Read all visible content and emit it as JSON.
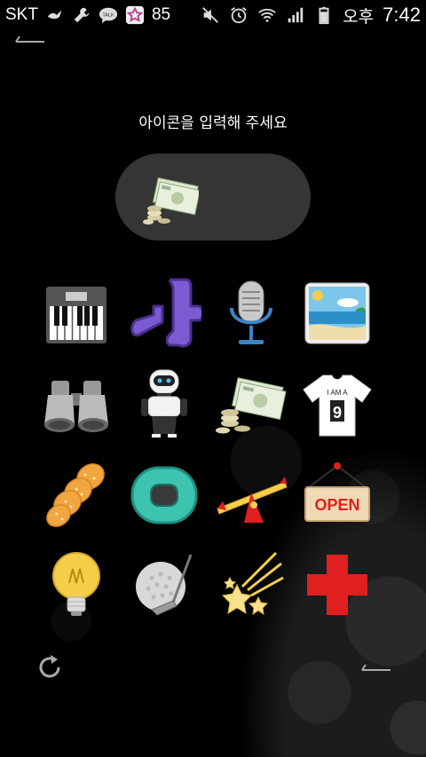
{
  "status_bar": {
    "carrier": "SKT",
    "battery_percent": "85",
    "ampm": "오후",
    "time": "7:42",
    "icons": [
      "bird-icon",
      "wrench-icon",
      "talk-icon",
      "star-app-icon",
      "mute-icon",
      "alarm-icon",
      "wifi-icon",
      "signal-icon",
      "battery-icon"
    ],
    "talk_label": "TALK"
  },
  "prompt": "아이콘을 입력해 주세요",
  "input": {
    "selected_icon": "money-icon"
  },
  "icons": [
    {
      "name": "piano-icon"
    },
    {
      "name": "hangul-na-icon"
    },
    {
      "name": "microphone-icon"
    },
    {
      "name": "beach-picture-icon"
    },
    {
      "name": "binoculars-icon"
    },
    {
      "name": "robot-icon"
    },
    {
      "name": "money-icon"
    },
    {
      "name": "tshirt-icon",
      "text_top": "I AM A",
      "text_num": "9"
    },
    {
      "name": "twisted-snack-icon"
    },
    {
      "name": "green-donut-icon"
    },
    {
      "name": "seesaw-icon"
    },
    {
      "name": "open-sign-icon",
      "text": "OPEN"
    },
    {
      "name": "lightbulb-icon"
    },
    {
      "name": "golf-icon"
    },
    {
      "name": "shooting-stars-icon"
    },
    {
      "name": "red-cross-icon"
    }
  ],
  "colors": {
    "pill": "#353535",
    "purple": "#7b5bd1",
    "teal": "#3cc4b0",
    "red": "#e02020",
    "yellow": "#f6cf4a"
  }
}
